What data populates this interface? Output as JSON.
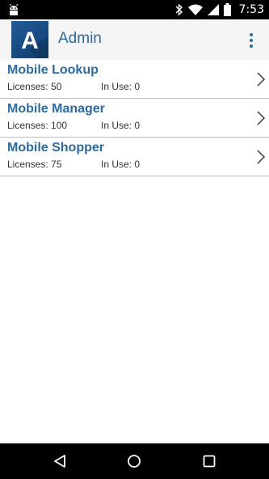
{
  "status_bar": {
    "time": "7:53",
    "icons": [
      "android-debug-icon",
      "bluetooth-icon",
      "wifi-icon",
      "signal-icon",
      "battery-icon"
    ]
  },
  "app_bar": {
    "logo_letter": "A",
    "title": "Admin",
    "menu_icon": "overflow-menu-icon"
  },
  "licenses": [
    {
      "name": "Mobile Lookup",
      "licenses": "Licenses: 50",
      "in_use": "In Use: 0"
    },
    {
      "name": "Mobile Manager",
      "licenses": "Licenses: 100",
      "in_use": "In Use: 0"
    },
    {
      "name": "Mobile Shopper",
      "licenses": "Licenses: 75",
      "in_use": "In Use: 0"
    }
  ],
  "nav_bar": {
    "icons": [
      "back-icon",
      "home-icon",
      "recents-icon"
    ]
  },
  "colors": {
    "accent": "#2b6aa5",
    "logo_blue": "#1f5a96",
    "divider": "#bdbdbd",
    "app_bar_bg": "#f5f5f5"
  }
}
